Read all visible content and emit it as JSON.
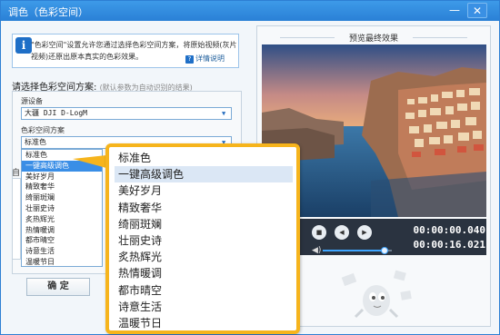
{
  "window": {
    "title": "调色（色彩空间）",
    "minimize_label": "—",
    "close_label": "✕"
  },
  "info": {
    "text": "\"色彩空间\"设置允许您通过选择色彩空间方案，将原始视频(灰片视频)还原出原本真实的色彩效果。",
    "detail_link": "详情说明"
  },
  "section": {
    "label": "请选择色彩空间方案:",
    "hint": "(默认参数为自动识别的结果)"
  },
  "source_device": {
    "label": "源设备",
    "value": "大疆 DJI D-LogM"
  },
  "color_scheme": {
    "label": "色彩空间方案",
    "value": "标准色"
  },
  "auto_label": "自",
  "dropdown_options": [
    "标准色",
    "一键高级调色",
    "美好岁月",
    "精致奢华",
    "绮丽斑斓",
    "壮丽史诗",
    "炙热辉光",
    "热情暖调",
    "都市晴空",
    "诗意生活",
    "温暖节日"
  ],
  "dropdown_selected_index": 1,
  "ok_button": "确 定",
  "preview": {
    "title": "预览最终效果",
    "time_current": "00:00:00.040",
    "time_total": "00:00:16.021",
    "volume_level": 0.9
  },
  "icons": {
    "info": "info-icon",
    "help": "question-icon",
    "stop": "stop-icon",
    "prev": "previous-icon",
    "next": "next-icon",
    "volume": "speaker-icon"
  },
  "colors": {
    "accent": "#2a80d6",
    "highlight": "#f6b41c",
    "selection": "#3a8ee6"
  }
}
